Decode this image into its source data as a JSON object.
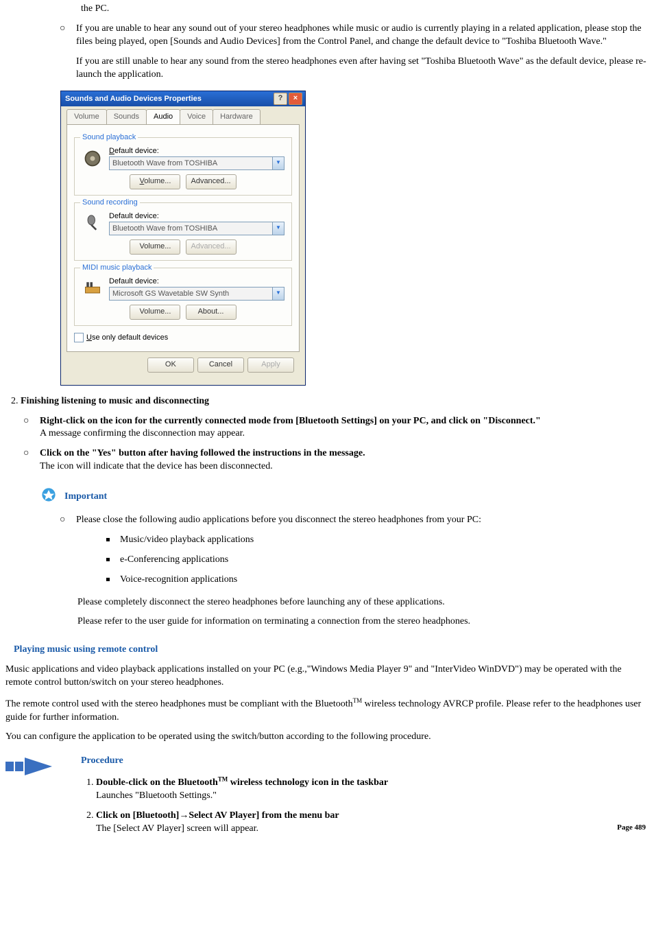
{
  "intro": {
    "line0": "the PC.",
    "para1": "If you are unable to hear any sound out of your stereo headphones while music or audio is currently playing in a related application, please stop the files being played, open [Sounds and Audio Devices] from the Control Panel, and change the default device to \"Toshiba Bluetooth Wave.\"",
    "para2": "If you are still unable to hear any sound from the stereo headphones even after having set \"Toshiba Bluetooth Wave\" as the default device, please re-launch the application."
  },
  "dialog": {
    "title": "Sounds and Audio Devices Properties",
    "help": "?",
    "close": "×",
    "tabs": [
      "Volume",
      "Sounds",
      "Audio",
      "Voice",
      "Hardware"
    ],
    "active_tab_index": 2,
    "playback": {
      "legend": "Sound playback",
      "label": "Default device:",
      "value": "Bluetooth Wave from TOSHIBA",
      "btn1": "Volume...",
      "btn2": "Advanced..."
    },
    "recording": {
      "legend": "Sound recording",
      "label": "Default device:",
      "value": "Bluetooth Wave from TOSHIBA",
      "btn1": "Volume...",
      "btn2": "Advanced..."
    },
    "midi": {
      "legend": "MIDI music playback",
      "label": "Default device:",
      "value": "Microsoft GS Wavetable SW Synth",
      "btn1": "Volume...",
      "btn2": "About..."
    },
    "use_only": "Use only default devices",
    "ok": "OK",
    "cancel": "Cancel",
    "apply": "Apply"
  },
  "step2": {
    "num": "2.",
    "title": "Finishing listening to music and disconnecting",
    "items": [
      {
        "bold": "Right-click on the icon for the currently connected mode from [Bluetooth Settings] on your PC, and click on \"Disconnect.\"",
        "plain": "A message confirming the disconnection may appear."
      },
      {
        "bold": "Click on the \"Yes\" button after having followed the instructions in the message.",
        "plain": "The icon will indicate that the device has been disconnected."
      }
    ]
  },
  "important": {
    "label": "Important",
    "intro": "Please close the following audio applications before you disconnect the stereo headphones from your PC:",
    "apps": [
      "Music/video playback applications",
      "e-Conferencing applications",
      "Voice-recognition applications"
    ],
    "p1": "Please completely disconnect the stereo headphones before launching any of these applications.",
    "p2": "Please refer to the user guide for information on terminating a connection from the stereo headphones."
  },
  "remote": {
    "heading": "Playing music using remote control",
    "p1": "Music applications and video playback applications installed on your PC (e.g.,\"Windows Media Player 9\" and \"InterVideo WinDVD\") may be operated with the remote control button/switch on your stereo headphones.",
    "p2a": "The remote control used with the stereo headphones must be compliant with the Bluetooth",
    "p2b": " wireless technology AVRCP profile. Please refer to the headphones user guide for further information.",
    "tm": "TM",
    "p3": "You can configure the application to be operated using the switch/button according to the following procedure."
  },
  "procedure": {
    "label": "Procedure",
    "items": [
      {
        "bold_a": "Double-click on the Bluetooth",
        "bold_tm": "TM",
        "bold_b": " wireless technology icon in the taskbar",
        "plain": "Launches \"Bluetooth Settings.\""
      },
      {
        "bold": "Click on [Bluetooth]→Select AV Player] from the menu bar",
        "plain": "The [Select AV Player] screen will appear."
      }
    ]
  },
  "page_number": "Page  489"
}
